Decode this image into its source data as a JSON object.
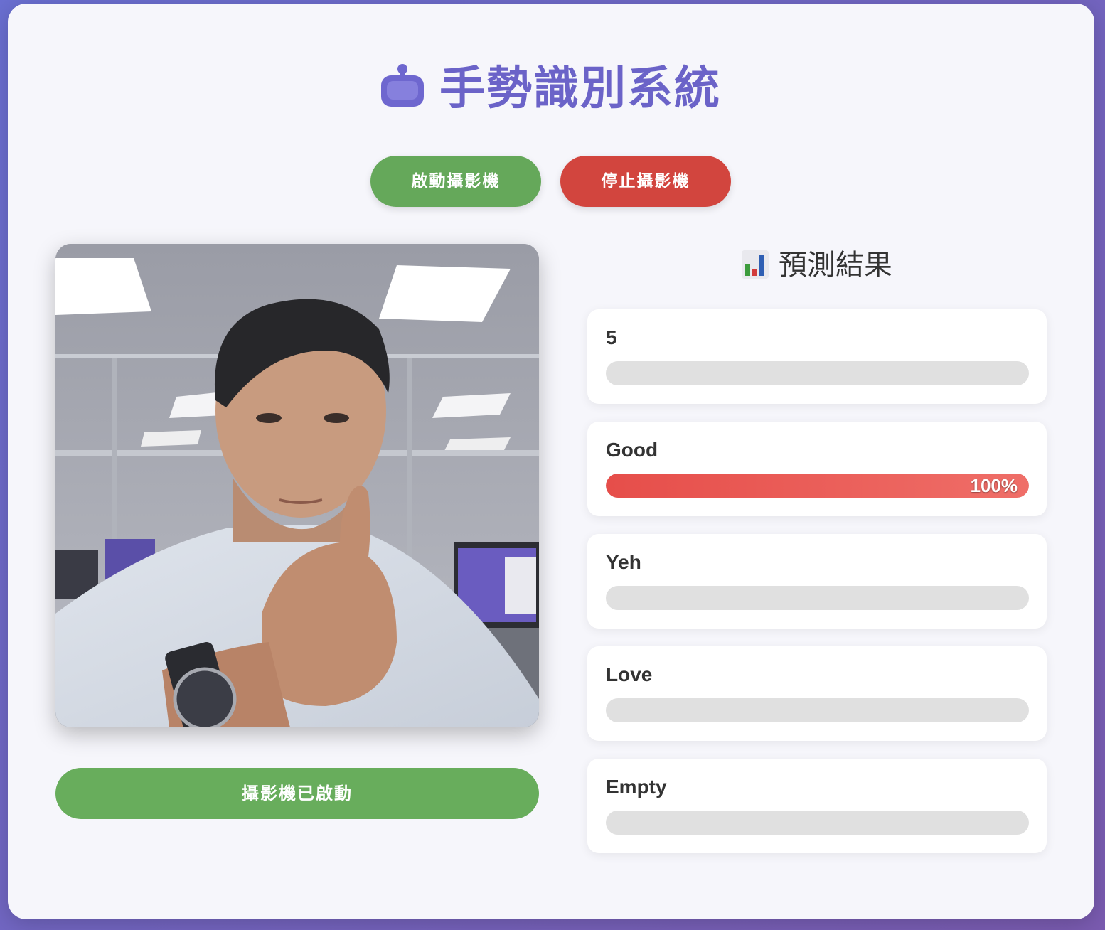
{
  "header": {
    "title": "手勢識別系統",
    "icon": "robot-icon"
  },
  "controls": {
    "start_label": "啟動攝影機",
    "stop_label": "停止攝影機"
  },
  "camera": {
    "status_label": "攝影機已啟動"
  },
  "predictions": {
    "title": "預測結果",
    "icon": "bar-chart-icon",
    "items": [
      {
        "label": "5",
        "value": 0,
        "percent_text": ""
      },
      {
        "label": "Good",
        "value": 1.0,
        "percent_text": "100%"
      },
      {
        "label": "Yeh",
        "value": 0,
        "percent_text": ""
      },
      {
        "label": "Love",
        "value": 0,
        "percent_text": ""
      },
      {
        "label": "Empty",
        "value": 0,
        "percent_text": ""
      }
    ]
  },
  "colors": {
    "title": "#6b63c8",
    "start_button": "#65a85a",
    "stop_button": "#d2453e",
    "status_bar": "#68ad5c",
    "bar_fill": "#e64e4a",
    "bar_track": "#e0e0e0"
  }
}
